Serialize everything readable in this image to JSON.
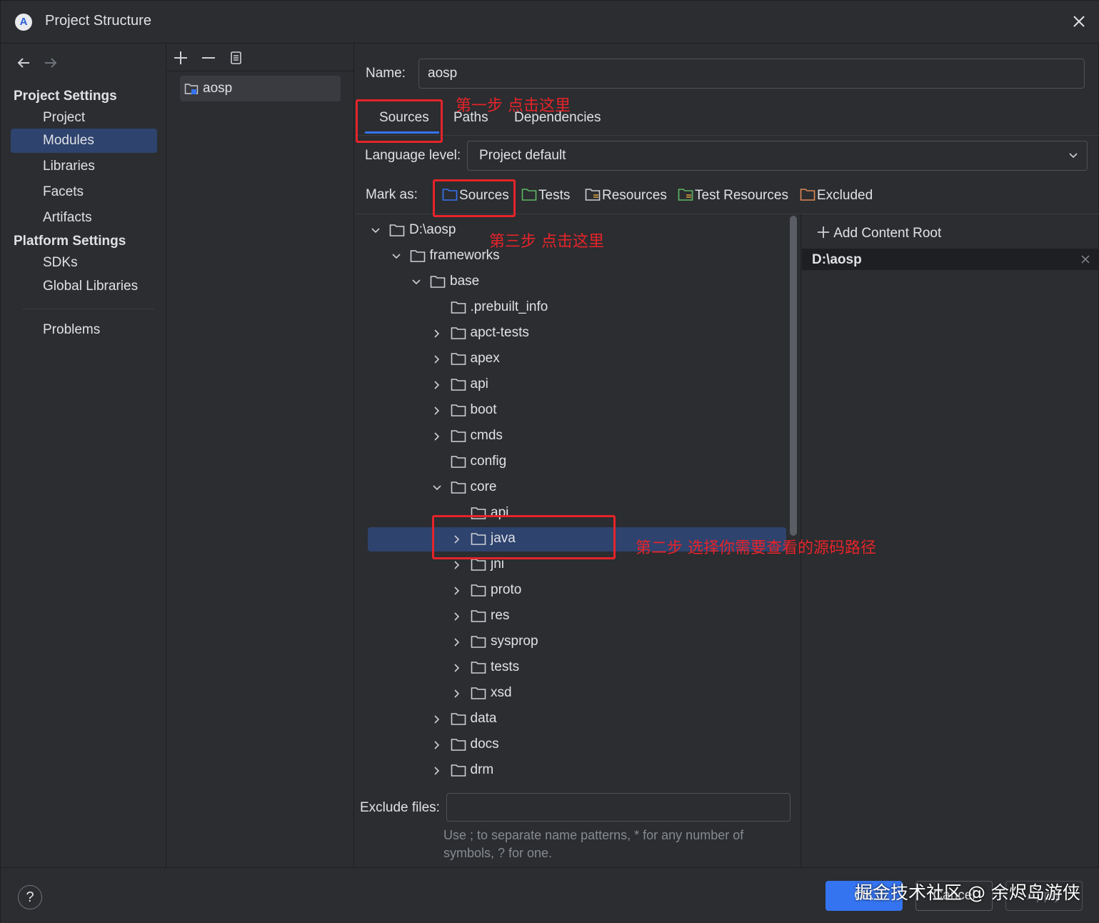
{
  "window": {
    "title": "Project Structure",
    "logo_glyph": "A"
  },
  "nav": {
    "project_settings_header": "Project Settings",
    "project_settings_items": [
      {
        "label": "Project"
      },
      {
        "label": "Modules",
        "selected": true
      },
      {
        "label": "Libraries"
      },
      {
        "label": "Facets"
      },
      {
        "label": "Artifacts"
      }
    ],
    "platform_settings_header": "Platform Settings",
    "platform_settings_items": [
      {
        "label": "SDKs"
      },
      {
        "label": "Global Libraries"
      }
    ],
    "problems_label": "Problems"
  },
  "modules": {
    "items": [
      {
        "label": "aosp"
      }
    ]
  },
  "main": {
    "name_label": "Name:",
    "name_value": "aosp",
    "tabs": [
      {
        "label": "Sources",
        "active": true
      },
      {
        "label": "Paths"
      },
      {
        "label": "Dependencies"
      }
    ],
    "language_level_label": "Language level:",
    "language_level_value": "Project default",
    "mark_as_label": "Mark as:",
    "mark_as": [
      {
        "label": "Sources",
        "icon": "sources-folder-icon",
        "color": "#3574f0"
      },
      {
        "label": "Tests",
        "icon": "tests-folder-icon",
        "color": "#5fb865"
      },
      {
        "label": "Resources",
        "icon": "resources-folder-icon",
        "color": "#ced0d6"
      },
      {
        "label": "Test Resources",
        "icon": "test-resources-folder-icon",
        "color": "#5fb865"
      },
      {
        "label": "Excluded",
        "icon": "excluded-folder-icon",
        "color": "#e08855"
      }
    ],
    "exclude_files_label": "Exclude files:",
    "exclude_files_value": "",
    "exclude_hint": "Use ; to separate name patterns, * for any number of symbols, ? for one."
  },
  "tree": [
    {
      "label": "D:\\aosp",
      "depth": 0,
      "expander": "expanded"
    },
    {
      "label": "frameworks",
      "depth": 1,
      "expander": "expanded"
    },
    {
      "label": "base",
      "depth": 2,
      "expander": "expanded"
    },
    {
      "label": ".prebuilt_info",
      "depth": 3,
      "expander": "none"
    },
    {
      "label": "apct-tests",
      "depth": 3,
      "expander": "collapsed"
    },
    {
      "label": "apex",
      "depth": 3,
      "expander": "collapsed"
    },
    {
      "label": "api",
      "depth": 3,
      "expander": "collapsed"
    },
    {
      "label": "boot",
      "depth": 3,
      "expander": "collapsed"
    },
    {
      "label": "cmds",
      "depth": 3,
      "expander": "collapsed"
    },
    {
      "label": "config",
      "depth": 3,
      "expander": "none"
    },
    {
      "label": "core",
      "depth": 3,
      "expander": "expanded"
    },
    {
      "label": "api",
      "depth": 4,
      "expander": "none"
    },
    {
      "label": "java",
      "depth": 4,
      "expander": "collapsed",
      "selected": true
    },
    {
      "label": "jni",
      "depth": 4,
      "expander": "collapsed"
    },
    {
      "label": "proto",
      "depth": 4,
      "expander": "collapsed"
    },
    {
      "label": "res",
      "depth": 4,
      "expander": "collapsed"
    },
    {
      "label": "sysprop",
      "depth": 4,
      "expander": "collapsed"
    },
    {
      "label": "tests",
      "depth": 4,
      "expander": "collapsed"
    },
    {
      "label": "xsd",
      "depth": 4,
      "expander": "collapsed"
    },
    {
      "label": "data",
      "depth": 3,
      "expander": "collapsed"
    },
    {
      "label": "docs",
      "depth": 3,
      "expander": "collapsed"
    },
    {
      "label": "drm",
      "depth": 3,
      "expander": "collapsed"
    }
  ],
  "right_panel": {
    "add_content_root": "Add Content Root",
    "content_root": "D:\\aosp"
  },
  "annotations": {
    "step1": "第一步 点击这里",
    "step2": "第二步 选择你需要查看的源码路径",
    "step3": "第三步 点击这里",
    "color": "#e5242a"
  },
  "buttons": {
    "help": "?",
    "ok": "OK",
    "cancel": "Cancel",
    "apply": "Apply"
  },
  "watermark": "掘金技术社区 @ 余烬岛游侠",
  "colors": {
    "background": "#2b2d30",
    "selection": "#2e436e",
    "accent": "#3574f0"
  }
}
